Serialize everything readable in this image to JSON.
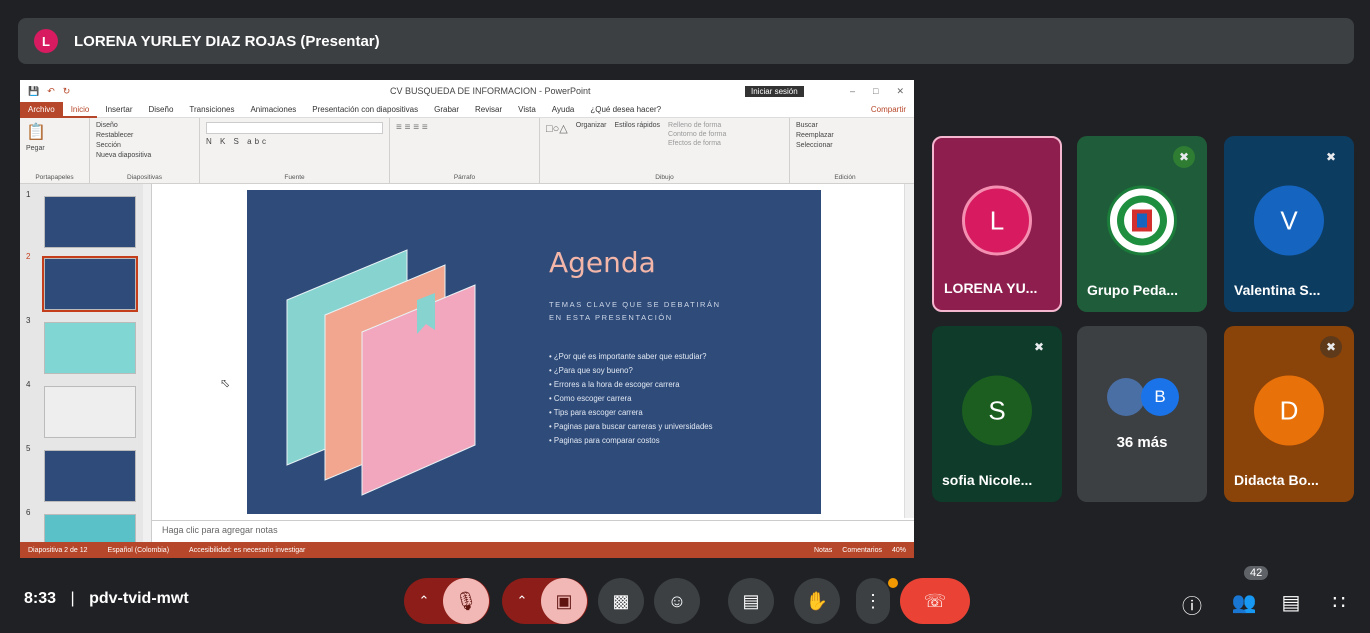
{
  "banner": {
    "avatar_letter": "L",
    "presenter": "LORENA YURLEY DIAZ ROJAS (Presentar)"
  },
  "ppt": {
    "doc_title": "CV BUSQUEDA DE INFORMACION  -  PowerPoint",
    "signin": "Iniciar sesión",
    "tabs": [
      "Archivo",
      "Inicio",
      "Insertar",
      "Diseño",
      "Transiciones",
      "Animaciones",
      "Presentación con diapositivas",
      "Grabar",
      "Revisar",
      "Vista",
      "Ayuda",
      "¿Qué desea hacer?"
    ],
    "share": "Compartir",
    "ribbon": {
      "clipboard": "Portapapeles",
      "paste": "Pegar",
      "slides": "Diapositivas",
      "new_slide": "Nueva diapositiva",
      "layout": "Diseño",
      "reset": "Restablecer",
      "section": "Sección",
      "font": "Fuente",
      "paragraph": "Párrafo",
      "drawing": "Dibujo",
      "arrange": "Organizar",
      "quick_styles": "Estilos rápidos",
      "fill": "Relleno de forma",
      "outline": "Contorno de forma",
      "effects": "Efectos de forma",
      "editing": "Edición",
      "find": "Buscar",
      "replace": "Reemplazar",
      "select": "Seleccionar"
    },
    "thumb_numbers": [
      "1",
      "2",
      "3",
      "4",
      "5",
      "6"
    ],
    "slide": {
      "title": "Agenda",
      "subtitle_1": "TEMAS CLAVE QUE SE DEBATIRÁN",
      "subtitle_2": "EN ESTA PRESENTACIÓN",
      "bullets": [
        "¿Por qué es importante saber que estudiar?",
        "¿Para que soy bueno?",
        "Errores a la hora de escoger carrera",
        "Como escoger carrera",
        "Tips para escoger carrera",
        "Paginas para buscar carreras y universidades",
        "Paginas para comparar costos"
      ]
    },
    "notes_placeholder": "Haga clic para agregar notas",
    "status": {
      "slide_count": "Diapositiva 2 de 12",
      "language": "Español (Colombia)",
      "accessibility": "Accesibilidad: es necesario investigar",
      "notes": "Notas",
      "comments": "Comentarios",
      "zoom": "40%"
    }
  },
  "participants": [
    {
      "name": "LORENA YU...",
      "initial": "L",
      "color": "#d81b60"
    },
    {
      "name": "Grupo Peda...",
      "initial": "",
      "color": "#2e7d32"
    },
    {
      "name": "Valentina S...",
      "initial": "V",
      "color": "#1565c0"
    },
    {
      "name": "sofia Nicole...",
      "initial": "S",
      "color": "#1b5e20"
    },
    {
      "name": "36 más",
      "initial": "B",
      "color": "#1a73e8"
    },
    {
      "name": "Didacta Bo...",
      "initial": "D",
      "color": "#e8710a"
    }
  ],
  "bottom": {
    "time": "8:33",
    "separator": "|",
    "code": "pdv-tvid-mwt",
    "people_count": "42"
  }
}
